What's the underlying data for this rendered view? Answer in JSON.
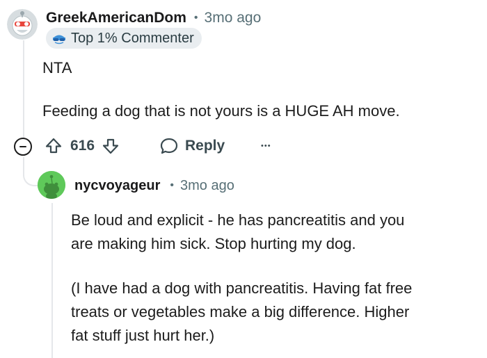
{
  "comment": {
    "username": "GreekAmericanDom",
    "separator": "•",
    "time": "3mo ago",
    "badge_label": "Top 1% Commenter",
    "badge_icon": "sunglasses-icon",
    "paragraphs": [
      "NTA",
      "Feeding a dog that is not yours is a HUGE AH move."
    ],
    "votes": "616",
    "reply_label": "Reply",
    "more_label": "•••"
  },
  "reply": {
    "username": "nycvoyageur",
    "separator": "•",
    "time": "3mo ago",
    "lines_p1": [
      "Be loud and explicit - he has pancreatitis and you",
      "are making him sick.  Stop hurting my dog."
    ],
    "lines_p2": [
      "(I have had a dog with pancreatitis.  Having fat free",
      "treats or vegetables make a big difference.  Higher",
      "fat stuff just hurt her.)"
    ]
  },
  "colors": {
    "meta_gray": "#576f76",
    "badge_bg": "#e9edf0",
    "reply_avatar_green": "#5fc95a",
    "thread_line": "#e5e7ea"
  }
}
